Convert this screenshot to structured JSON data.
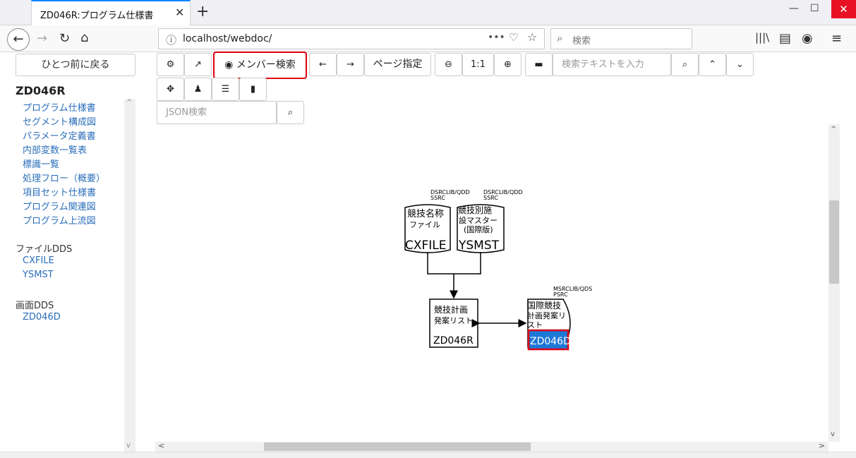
{
  "browser": {
    "tab_title": "ZD046R:プログラム仕様書",
    "new_tab": "+",
    "url": "localhost/webdoc/",
    "search_placeholder": "検索"
  },
  "sidebar": {
    "back_button": "ひとつ前に戻る",
    "title": "ZD046R",
    "links": [
      "プログラム仕様書",
      "セグメント構成図",
      "パラメータ定義書",
      "内部変数一覧表",
      "標識一覧",
      "処理フロー（概要）",
      "項目セット仕様書",
      "プログラム関連図",
      "プログラム上流図"
    ],
    "file_dds_heading": "ファイルDDS",
    "file_dds": [
      "CXFILE",
      "YSMST"
    ],
    "screen_dds_heading": "画面DDS",
    "screen_dds": [
      "ZD046D"
    ]
  },
  "toolbar": {
    "member_search": "メンバー検索",
    "page_jump": "ページ指定",
    "zoom_reset": "1:1",
    "search_text_placeholder": "検索テキストを入力",
    "json_search_placeholder": "JSON検索"
  },
  "diagram": {
    "file1": {
      "lib": "DSRCLIB/QDD",
      "src": "SSRC",
      "line1": "競技名称",
      "line2": "ファイル",
      "name": "CXFILE"
    },
    "file2": {
      "lib": "DSRCLIB/QDD",
      "src": "SSRC",
      "line1": "競技別施",
      "line2": "設マスター",
      "line3": "(国際版)",
      "name": "YSMST"
    },
    "program": {
      "line1": "競技計画",
      "line2": "発案リスト",
      "name": "ZD046R"
    },
    "screen": {
      "lib": "MSRCLIB/QDS",
      "src": "PSRC",
      "line1": "国際競技",
      "line2": "計画発案リ",
      "line3": "スト",
      "name": "ZD046D"
    }
  },
  "colors": {
    "link": "#2a6ebb",
    "highlight": "#e00010",
    "selected": "#1e78d6"
  }
}
